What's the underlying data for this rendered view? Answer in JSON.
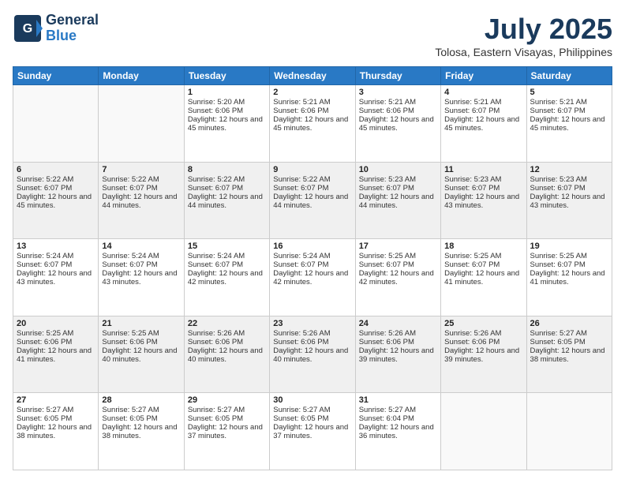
{
  "header": {
    "logo_line1": "General",
    "logo_line2": "Blue",
    "month_title": "July 2025",
    "location": "Tolosa, Eastern Visayas, Philippines"
  },
  "weekdays": [
    "Sunday",
    "Monday",
    "Tuesday",
    "Wednesday",
    "Thursday",
    "Friday",
    "Saturday"
  ],
  "weeks": [
    [
      {
        "day": "",
        "sunrise": "",
        "sunset": "",
        "daylight": ""
      },
      {
        "day": "",
        "sunrise": "",
        "sunset": "",
        "daylight": ""
      },
      {
        "day": "1",
        "sunrise": "Sunrise: 5:20 AM",
        "sunset": "Sunset: 6:06 PM",
        "daylight": "Daylight: 12 hours and 45 minutes."
      },
      {
        "day": "2",
        "sunrise": "Sunrise: 5:21 AM",
        "sunset": "Sunset: 6:06 PM",
        "daylight": "Daylight: 12 hours and 45 minutes."
      },
      {
        "day": "3",
        "sunrise": "Sunrise: 5:21 AM",
        "sunset": "Sunset: 6:06 PM",
        "daylight": "Daylight: 12 hours and 45 minutes."
      },
      {
        "day": "4",
        "sunrise": "Sunrise: 5:21 AM",
        "sunset": "Sunset: 6:07 PM",
        "daylight": "Daylight: 12 hours and 45 minutes."
      },
      {
        "day": "5",
        "sunrise": "Sunrise: 5:21 AM",
        "sunset": "Sunset: 6:07 PM",
        "daylight": "Daylight: 12 hours and 45 minutes."
      }
    ],
    [
      {
        "day": "6",
        "sunrise": "Sunrise: 5:22 AM",
        "sunset": "Sunset: 6:07 PM",
        "daylight": "Daylight: 12 hours and 45 minutes."
      },
      {
        "day": "7",
        "sunrise": "Sunrise: 5:22 AM",
        "sunset": "Sunset: 6:07 PM",
        "daylight": "Daylight: 12 hours and 44 minutes."
      },
      {
        "day": "8",
        "sunrise": "Sunrise: 5:22 AM",
        "sunset": "Sunset: 6:07 PM",
        "daylight": "Daylight: 12 hours and 44 minutes."
      },
      {
        "day": "9",
        "sunrise": "Sunrise: 5:22 AM",
        "sunset": "Sunset: 6:07 PM",
        "daylight": "Daylight: 12 hours and 44 minutes."
      },
      {
        "day": "10",
        "sunrise": "Sunrise: 5:23 AM",
        "sunset": "Sunset: 6:07 PM",
        "daylight": "Daylight: 12 hours and 44 minutes."
      },
      {
        "day": "11",
        "sunrise": "Sunrise: 5:23 AM",
        "sunset": "Sunset: 6:07 PM",
        "daylight": "Daylight: 12 hours and 43 minutes."
      },
      {
        "day": "12",
        "sunrise": "Sunrise: 5:23 AM",
        "sunset": "Sunset: 6:07 PM",
        "daylight": "Daylight: 12 hours and 43 minutes."
      }
    ],
    [
      {
        "day": "13",
        "sunrise": "Sunrise: 5:24 AM",
        "sunset": "Sunset: 6:07 PM",
        "daylight": "Daylight: 12 hours and 43 minutes."
      },
      {
        "day": "14",
        "sunrise": "Sunrise: 5:24 AM",
        "sunset": "Sunset: 6:07 PM",
        "daylight": "Daylight: 12 hours and 43 minutes."
      },
      {
        "day": "15",
        "sunrise": "Sunrise: 5:24 AM",
        "sunset": "Sunset: 6:07 PM",
        "daylight": "Daylight: 12 hours and 42 minutes."
      },
      {
        "day": "16",
        "sunrise": "Sunrise: 5:24 AM",
        "sunset": "Sunset: 6:07 PM",
        "daylight": "Daylight: 12 hours and 42 minutes."
      },
      {
        "day": "17",
        "sunrise": "Sunrise: 5:25 AM",
        "sunset": "Sunset: 6:07 PM",
        "daylight": "Daylight: 12 hours and 42 minutes."
      },
      {
        "day": "18",
        "sunrise": "Sunrise: 5:25 AM",
        "sunset": "Sunset: 6:07 PM",
        "daylight": "Daylight: 12 hours and 41 minutes."
      },
      {
        "day": "19",
        "sunrise": "Sunrise: 5:25 AM",
        "sunset": "Sunset: 6:07 PM",
        "daylight": "Daylight: 12 hours and 41 minutes."
      }
    ],
    [
      {
        "day": "20",
        "sunrise": "Sunrise: 5:25 AM",
        "sunset": "Sunset: 6:06 PM",
        "daylight": "Daylight: 12 hours and 41 minutes."
      },
      {
        "day": "21",
        "sunrise": "Sunrise: 5:25 AM",
        "sunset": "Sunset: 6:06 PM",
        "daylight": "Daylight: 12 hours and 40 minutes."
      },
      {
        "day": "22",
        "sunrise": "Sunrise: 5:26 AM",
        "sunset": "Sunset: 6:06 PM",
        "daylight": "Daylight: 12 hours and 40 minutes."
      },
      {
        "day": "23",
        "sunrise": "Sunrise: 5:26 AM",
        "sunset": "Sunset: 6:06 PM",
        "daylight": "Daylight: 12 hours and 40 minutes."
      },
      {
        "day": "24",
        "sunrise": "Sunrise: 5:26 AM",
        "sunset": "Sunset: 6:06 PM",
        "daylight": "Daylight: 12 hours and 39 minutes."
      },
      {
        "day": "25",
        "sunrise": "Sunrise: 5:26 AM",
        "sunset": "Sunset: 6:06 PM",
        "daylight": "Daylight: 12 hours and 39 minutes."
      },
      {
        "day": "26",
        "sunrise": "Sunrise: 5:27 AM",
        "sunset": "Sunset: 6:05 PM",
        "daylight": "Daylight: 12 hours and 38 minutes."
      }
    ],
    [
      {
        "day": "27",
        "sunrise": "Sunrise: 5:27 AM",
        "sunset": "Sunset: 6:05 PM",
        "daylight": "Daylight: 12 hours and 38 minutes."
      },
      {
        "day": "28",
        "sunrise": "Sunrise: 5:27 AM",
        "sunset": "Sunset: 6:05 PM",
        "daylight": "Daylight: 12 hours and 38 minutes."
      },
      {
        "day": "29",
        "sunrise": "Sunrise: 5:27 AM",
        "sunset": "Sunset: 6:05 PM",
        "daylight": "Daylight: 12 hours and 37 minutes."
      },
      {
        "day": "30",
        "sunrise": "Sunrise: 5:27 AM",
        "sunset": "Sunset: 6:05 PM",
        "daylight": "Daylight: 12 hours and 37 minutes."
      },
      {
        "day": "31",
        "sunrise": "Sunrise: 5:27 AM",
        "sunset": "Sunset: 6:04 PM",
        "daylight": "Daylight: 12 hours and 36 minutes."
      },
      {
        "day": "",
        "sunrise": "",
        "sunset": "",
        "daylight": ""
      },
      {
        "day": "",
        "sunrise": "",
        "sunset": "",
        "daylight": ""
      }
    ]
  ]
}
